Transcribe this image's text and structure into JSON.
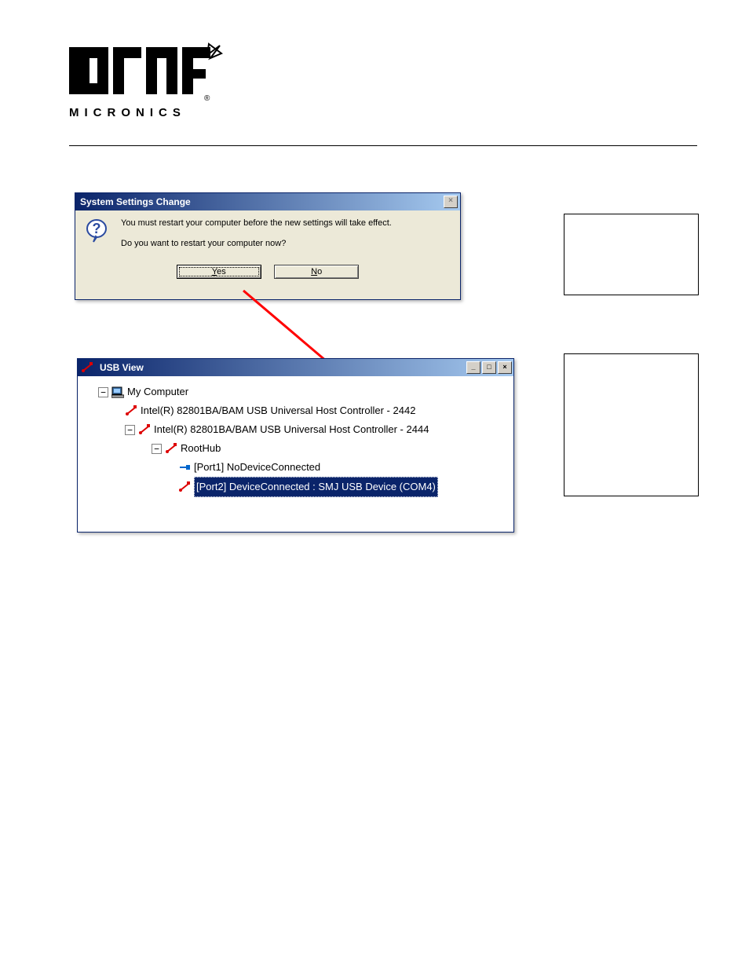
{
  "dialog": {
    "title": "System Settings Change",
    "line1": "You must restart your computer before the new settings will take effect.",
    "line2": "Do you want to restart your computer now?",
    "yes": "Yes",
    "no": "No"
  },
  "usbview": {
    "title": "USB View",
    "root": "My Computer",
    "hc1": "Intel(R) 82801BA/BAM USB Universal Host Controller - 2442",
    "hc2": "Intel(R) 82801BA/BAM USB Universal Host Controller - 2444",
    "roothub": "RootHub",
    "port1": "[Port1] NoDeviceConnected",
    "port2": "[Port2] DeviceConnected : SMJ USB Device (COM4)"
  },
  "icons": {
    "question": "question-icon",
    "usb": "usb-icon",
    "computer": "computer-icon",
    "connector": "connector-icon"
  }
}
